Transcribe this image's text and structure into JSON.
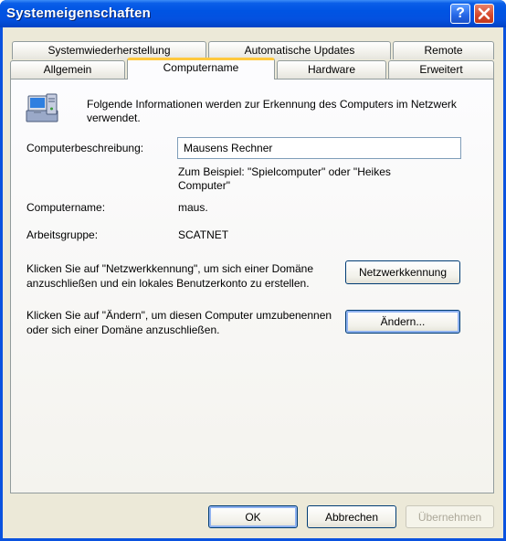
{
  "window": {
    "title": "Systemeigenschaften"
  },
  "icons": {
    "help": "?",
    "close": "✕"
  },
  "tabs": {
    "row1": [
      "Systemwiederherstellung",
      "Automatische Updates",
      "Remote"
    ],
    "row2": [
      "Allgemein",
      "Computername",
      "Hardware",
      "Erweitert"
    ],
    "active": "Computername"
  },
  "panel": {
    "intro": "Folgende Informationen werden zur Erkennung des Computers im Netzwerk verwendet.",
    "description_label": "Computerbeschreibung:",
    "description_value": "Mausens Rechner",
    "example": "Zum Beispiel: \"Spielcomputer\" oder \"Heikes Computer\"",
    "computername_label": "Computername:",
    "computername_value": "maus.",
    "workgroup_label": "Arbeitsgruppe:",
    "workgroup_value": "SCATNET",
    "network_text": "Klicken Sie auf \"Netzwerkkennung\", um sich einer Domäne anzuschließen und ein lokales Benutzerkonto zu erstellen.",
    "network_button": "Netzwerkkennung",
    "change_text": "Klicken Sie auf \"Ändern\", um diesen Computer umzubenennen oder sich einer Domäne anzuschließen.",
    "change_button": "Ändern..."
  },
  "footer": {
    "ok": "OK",
    "cancel": "Abbrechen",
    "apply": "Übernehmen"
  }
}
